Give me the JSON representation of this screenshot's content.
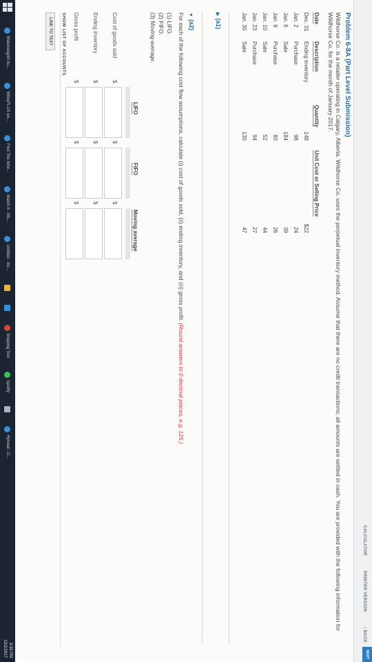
{
  "toolbar": {
    "calculator": "CALCULATOR",
    "printer_version": "PRINTER VERSION",
    "back": "‹ BACK",
    "next": "NEXT"
  },
  "problem": {
    "title": "Problem 6-8A (Part Level Submission)",
    "intro": "Wildhorse Co. is a retailer operating in Calgary, Alberta. Wildhorse Co. uses the perpetual inventory method. Assume that there are no credit transactions; all amounts are settled in cash. You are provided with the following information for Wildhorse Co. for the month of January 2017."
  },
  "inventory_table": {
    "headers": [
      "Date",
      "Description",
      "Quantity",
      "Unit Cost or Selling Price"
    ],
    "rows": [
      {
        "date": "Dec. 31",
        "desc": "Ending inventory",
        "qty": "148",
        "price": "$22"
      },
      {
        "date": "Jan. 2",
        "desc": "Purchase",
        "qty": "98",
        "price": "24"
      },
      {
        "date": "Jan. 6",
        "desc": "Sale",
        "qty": "184",
        "price": "39"
      },
      {
        "date": "Jan. 9",
        "desc": "Purchase",
        "qty": "80",
        "price": "26"
      },
      {
        "date": "Jan. 10",
        "desc": "Sale",
        "qty": "52",
        "price": "44"
      },
      {
        "date": "Jan. 23",
        "desc": "Purchase",
        "qty": "94",
        "price": "27"
      },
      {
        "date": "Jan. 30",
        "desc": "Sale",
        "qty": "130",
        "price": "47"
      }
    ]
  },
  "sections": {
    "a1_label": "(a1)",
    "a2_label": "(a2)",
    "a2_instruction": "For each of the following cost flow assumptions, calculate (i) cost of goods sold, (ii) ending inventory, and (iii) gross profit.",
    "a2_hint": "(Round answers to 0 decimal places, e.g. 125.)",
    "options": [
      "(1) LIFO.",
      "(2) FIFO.",
      "(3) Moving-average."
    ]
  },
  "answer_grid": {
    "columns": [
      "LIFO",
      "FIFO",
      "Moving average"
    ],
    "rows": [
      "Cost of goods sold",
      "Ending inventory",
      "Gross profit"
    ],
    "currency": "$"
  },
  "footer": {
    "show_list": "SHOW LIST OF ACCOUNTS",
    "link_to_text": "LINK TO TEXT"
  },
  "taskbar": {
    "items": [
      {
        "label": "WebAssign® Au...",
        "color": "#3a8fd8"
      },
      {
        "label": "WileyPLUS en...",
        "color": "#3a8fd8"
      },
      {
        "label": "Find The Infor...",
        "color": "#3a8fd8"
      },
      {
        "label": "Watch It - Mu...",
        "color": "#3a8fd8"
      },
      {
        "label": "Untitled - Inc...",
        "color": "#3a8fd8"
      },
      {
        "label": "",
        "color": "#e6b53a"
      },
      {
        "label": "",
        "color": "#3a8fd8"
      },
      {
        "label": "Snipping Tool",
        "color": "#d04a3a"
      },
      {
        "label": "Spotify",
        "color": "#3cbf58"
      },
      {
        "label": "",
        "color": "#aab4c0"
      },
      {
        "label": "Hymnal - D...",
        "color": "#3a8fd8"
      }
    ],
    "time": "3:33 PM",
    "date": "12/2/2017"
  }
}
